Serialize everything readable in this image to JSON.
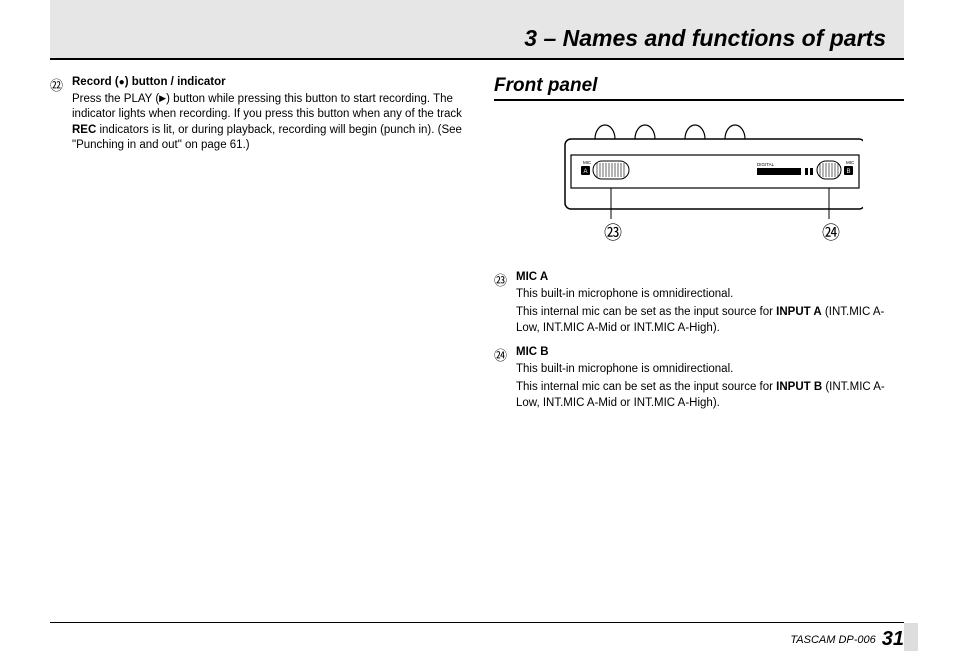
{
  "header": {
    "title": "3 – Names and functions of parts"
  },
  "left": {
    "item22": {
      "num": "㉒",
      "head_pre": "Record (",
      "head_post": ") button / indicator",
      "body_pre": "Press the PLAY (",
      "body_mid": ") button while pressing this button to start recording. The indicator lights when recording. If you press this button when any of the track ",
      "body_bold": "REC",
      "body_post": " indicators is lit, or during playback, recording will begin (punch in). (See \"Punching in and out\" on page 61.)"
    }
  },
  "right": {
    "section": "Front panel",
    "callout23": "㉓",
    "callout24": "㉔",
    "diagram_labels": {
      "mic_a": "MIC",
      "a": "A",
      "mic_b": "MIC",
      "b": "B",
      "digital": "DIGITAL"
    },
    "item23": {
      "num": "㉓",
      "head": "MIC A",
      "p1": "This built-in microphone is omnidirectional.",
      "p2_pre": "This internal mic can be set as the input source for ",
      "p2_bold": "INPUT A",
      "p2_post": " (INT.MIC A-Low, INT.MIC A-Mid or INT.MIC A-High)."
    },
    "item24": {
      "num": "㉔",
      "head": "MIC B",
      "p1": "This built-in microphone is omnidirectional.",
      "p2_pre": "This internal mic can be set as the input source for ",
      "p2_bold": "INPUT B",
      "p2_post": " (INT.MIC A-Low, INT.MIC A-Mid or INT.MIC A-High)."
    }
  },
  "footer": {
    "model": "TASCAM  DP-006",
    "page": "31"
  }
}
